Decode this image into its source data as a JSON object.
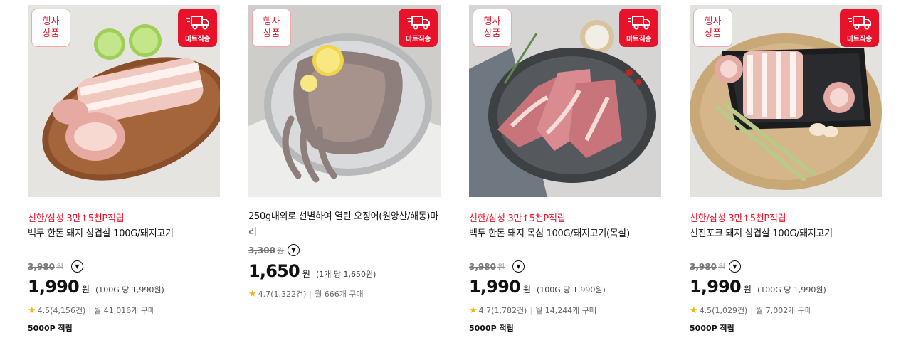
{
  "badges": {
    "event_line1": "행사",
    "event_line2": "상품",
    "mart": "마트직송"
  },
  "products": [
    {
      "promo": "신한/삼성 3만↑5천P적립",
      "title": "백두 한돈 돼지 삼겹살 100G/돼지고기",
      "original_price": "3,980",
      "won": "원",
      "price": "1,990",
      "unit_price": "(100G 당 1,990원)",
      "rating": "4.5",
      "review_count": "(4,156건)",
      "monthly_sales": "월 41,016개 구매",
      "points": "5000P 적립",
      "icon": "chevron-down-icon"
    },
    {
      "promo": "",
      "title": "250g내외로 선별하여 열린 오징어(원양산/해동)마리",
      "original_price": "3,300",
      "won": "원",
      "price": "1,650",
      "unit_price": "(1개 당 1,650원)",
      "rating": "4.7",
      "review_count": "(1,322건)",
      "monthly_sales": "월 666개 구매",
      "points": "",
      "icon": "chevron-down-icon"
    },
    {
      "promo": "신한/삼성 3만↑5천P적립",
      "title": "백두 한돈 돼지 목심 100G/돼지고기(목살)",
      "original_price": "3,980",
      "won": "원",
      "price": "1,990",
      "unit_price": "(100G 당 1,990원)",
      "rating": "4.7",
      "review_count": "(1,782건)",
      "monthly_sales": "월 14,244개 구매",
      "points": "5000P 적립",
      "icon": "chevron-down-icon"
    },
    {
      "promo": "신한/삼성 3만↑5천P적립",
      "title": "선진포크 돼지 삼겹살 100G/돼지고기",
      "original_price": "3,980",
      "won": "원",
      "price": "1,990",
      "unit_price": "(100G 당 1,990원)",
      "rating": "4.5",
      "review_count": "(1,029건)",
      "monthly_sales": "월 7,002개 구매",
      "points": "5000P 적립",
      "icon": "chevron-down-icon"
    }
  ],
  "colors": {
    "accent_red": "#e8132b",
    "star": "#f5b50a"
  }
}
